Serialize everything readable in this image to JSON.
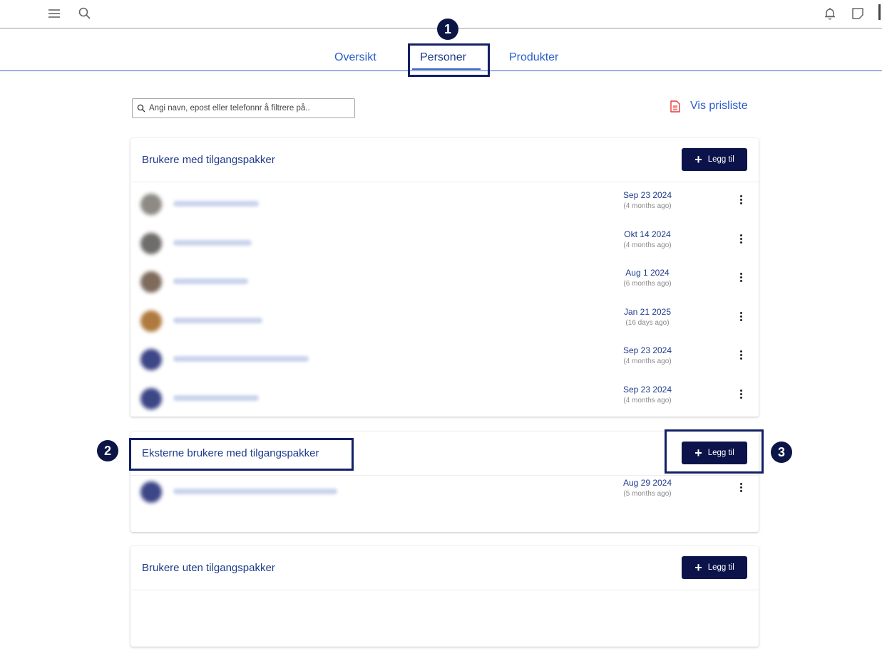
{
  "topbar": {
    "icons": [
      "menu-icon",
      "search-icon",
      "bell-icon",
      "note-icon"
    ]
  },
  "tabs": [
    {
      "label": "Oversikt"
    },
    {
      "label": "Personer",
      "active": true
    },
    {
      "label": "Produkter"
    }
  ],
  "filter": {
    "placeholder": "Angi navn, epost eller telefonnr å filtrere på.."
  },
  "prisliste": {
    "label": "Vis prisliste",
    "icon": "document-icon"
  },
  "add_label": "Legg til",
  "sections": [
    {
      "title": "Brukere med tilgangspakker",
      "rows": [
        {
          "date": "Sep 23 2024",
          "ago": "(4 months ago)"
        },
        {
          "date": "Okt 14 2024",
          "ago": "(4 months ago)"
        },
        {
          "date": "Aug 1 2024",
          "ago": "(6 months ago)"
        },
        {
          "date": "Jan 21 2025",
          "ago": "(16 days ago)"
        },
        {
          "date": "Sep 23 2024",
          "ago": "(4 months ago)"
        },
        {
          "date": "Sep 23 2024",
          "ago": "(4 months ago)"
        }
      ]
    },
    {
      "title": "Eksterne brukere med tilgangspakker",
      "rows": [
        {
          "date": "Aug 29 2024",
          "ago": "(5 months ago)"
        }
      ]
    },
    {
      "title": "Brukere uten tilgangspakker",
      "rows": []
    }
  ],
  "callouts": [
    "1",
    "2",
    "3"
  ],
  "colors": {
    "accent": "#2a5dc8",
    "button": "#0b134a",
    "callout": "#131f66",
    "pdf_icon": "#e53935"
  }
}
